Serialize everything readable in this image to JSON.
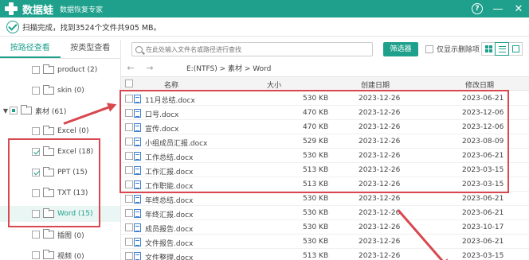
{
  "app": {
    "name": "数据蛙",
    "subtitle": "数据恢复专家",
    "help_label": "?",
    "minimize_label": "—",
    "close_label": "✕"
  },
  "status": {
    "text": "扫描完成，找到3524个文件共905 MB。"
  },
  "left_panel": {
    "tabs": [
      {
        "label": "按路径查看",
        "active": true
      },
      {
        "label": "按类型查看",
        "active": false
      }
    ],
    "tree": [
      {
        "label": "product (2)",
        "checked": false,
        "expanded": null
      },
      {
        "label": "skin (0)",
        "checked": false,
        "expanded": null
      },
      {
        "label": "素材 (61)",
        "checked": "partial",
        "expanded": true
      },
      {
        "label": "Excel (0)",
        "checked": false,
        "expanded": null
      },
      {
        "label": "Excel (18)",
        "checked": true,
        "expanded": null
      },
      {
        "label": "PPT (15)",
        "checked": true,
        "expanded": null
      },
      {
        "label": "TXT (13)",
        "checked": false,
        "expanded": null
      },
      {
        "label": "Word (15)",
        "checked": false,
        "expanded": null,
        "selected": true
      },
      {
        "label": "插图 (0)",
        "checked": false,
        "expanded": null
      },
      {
        "label": "视频 (0)",
        "checked": false,
        "expanded": null
      }
    ]
  },
  "toolbar": {
    "search_placeholder": "在此处输入文件名或路径进行查找",
    "filter_label": "筛选器",
    "deleted_only_label": "仅显示删除项",
    "view_modes": [
      "grid-view",
      "list-view",
      "detail-view"
    ]
  },
  "nav": {
    "back_label": "←",
    "forward_label": "→",
    "path": "E:(NTFS) > 素材 > Word"
  },
  "table": {
    "columns": [
      "名称",
      "大小",
      "创建日期",
      "修改日期"
    ],
    "rows": [
      {
        "name": "11月总结.docx",
        "size": "530 KB",
        "created": "2023-12-26",
        "modified": "2023-06-21"
      },
      {
        "name": "口号.docx",
        "size": "470 KB",
        "created": "2023-12-26",
        "modified": "2023-12-06"
      },
      {
        "name": "宣传.docx",
        "size": "470 KB",
        "created": "2023-12-26",
        "modified": "2023-12-06"
      },
      {
        "name": "小组成员汇报.docx",
        "size": "529 KB",
        "created": "2023-12-26",
        "modified": "2023-08-09"
      },
      {
        "name": "工作总结.docx",
        "size": "530 KB",
        "created": "2023-12-26",
        "modified": "2023-06-21"
      },
      {
        "name": "工作汇报.docx",
        "size": "513 KB",
        "created": "2023-12-26",
        "modified": "2023-03-15"
      },
      {
        "name": "工作职能.docx",
        "size": "513 KB",
        "created": "2023-12-26",
        "modified": "2023-03-15"
      },
      {
        "name": "年终总结.docx",
        "size": "530 KB",
        "created": "2023-12-26",
        "modified": "2023-06-21"
      },
      {
        "name": "年终汇报.docx",
        "size": "530 KB",
        "created": "2023-12-26",
        "modified": "2023-06-21"
      },
      {
        "name": "成员报告.docx",
        "size": "530 KB",
        "created": "2023-12-26",
        "modified": "2023-10-17"
      },
      {
        "name": "文件报告.docx",
        "size": "530 KB",
        "created": "2023-12-26",
        "modified": "2023-06-21"
      },
      {
        "name": "文件整理.docx",
        "size": "513 KB",
        "created": "2023-12-26",
        "modified": "2023-03-15"
      }
    ]
  },
  "colors": {
    "brand": "#1ea08c",
    "annotation": "#d9474f"
  }
}
